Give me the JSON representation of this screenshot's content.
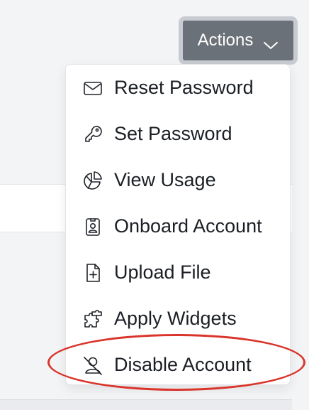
{
  "actions_button": {
    "label": "Actions",
    "bg_color": "#6b7178",
    "chevron": "chevron-down-icon"
  },
  "menu": {
    "items": [
      {
        "label": "Reset Password",
        "icon": "envelope-icon"
      },
      {
        "label": "Set Password",
        "icon": "key-icon"
      },
      {
        "label": "View Usage",
        "icon": "pie-chart-icon"
      },
      {
        "label": "Onboard Account",
        "icon": "id-badge-icon"
      },
      {
        "label": "Upload File",
        "icon": "file-plus-icon"
      },
      {
        "label": "Apply Widgets",
        "icon": "puzzle-icon"
      },
      {
        "label": "Disable Account",
        "icon": "user-slash-icon"
      }
    ]
  },
  "annotation": {
    "target": "Disable Account",
    "color": "#d9352b"
  }
}
